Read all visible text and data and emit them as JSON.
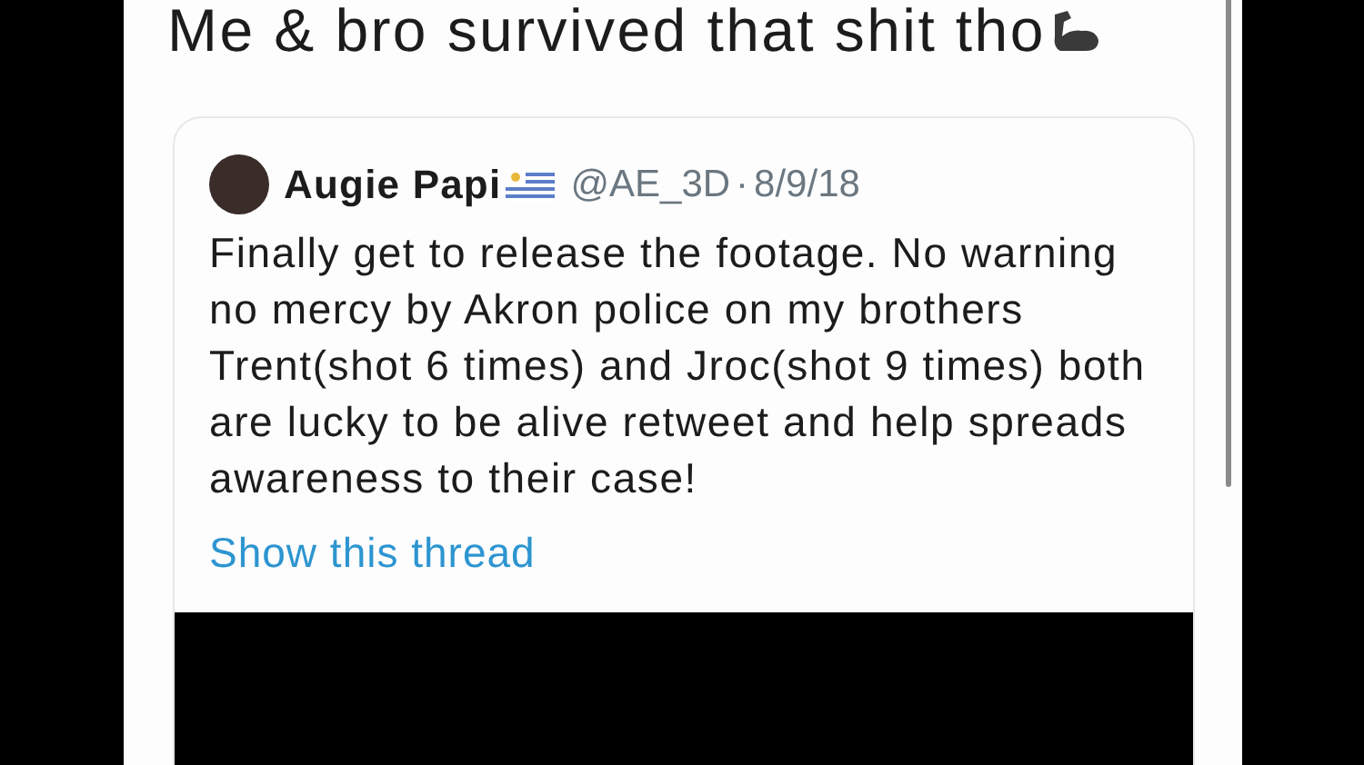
{
  "tweet": {
    "text": "Me & bro survived that shit tho"
  },
  "quoted_tweet": {
    "name": "Augie Papi",
    "handle": "@AE_3D",
    "separator": "·",
    "date": "8/9/18",
    "text": "Finally get to release the footage. No warning no mercy by Akron police on my brothers Trent(shot 6 times) and Jroc(shot 9 times) both are lucky to be alive retweet and help spreads awareness to their case!",
    "thread_link": "Show this thread"
  }
}
